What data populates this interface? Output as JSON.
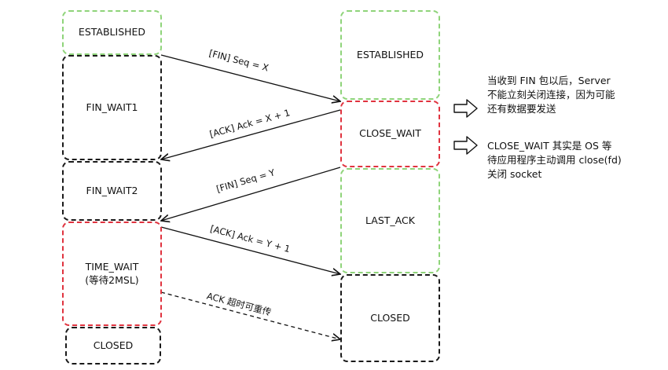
{
  "client": {
    "states": [
      {
        "id": "established",
        "label": "ESTABLISHED"
      },
      {
        "id": "fin_wait1",
        "label": "FIN_WAIT1"
      },
      {
        "id": "fin_wait2",
        "label": "FIN_WAIT2"
      },
      {
        "id": "time_wait",
        "label": "TIME_WAIT\n(等待2MSL)"
      },
      {
        "id": "closed",
        "label": "CLOSED"
      }
    ]
  },
  "server": {
    "states": [
      {
        "id": "established",
        "label": "ESTABLISHED"
      },
      {
        "id": "close_wait",
        "label": "CLOSE_WAIT"
      },
      {
        "id": "last_ack",
        "label": "LAST_ACK"
      },
      {
        "id": "closed",
        "label": "CLOSED"
      }
    ]
  },
  "messages": [
    {
      "label": "[FIN] Seq = X"
    },
    {
      "label": "[ACK] Ack = X + 1"
    },
    {
      "label": "[FIN] Seq = Y"
    },
    {
      "label": "[ACK] Ack = Y + 1"
    },
    {
      "label": "ACK 超时可重传"
    }
  ],
  "notes": [
    {
      "text": "当收到 FIN 包以后，Server\n不能立刻关闭连接，因为可能\n还有数据要发送"
    },
    {
      "text": "CLOSE_WAIT 其实是 OS 等\n待应用程序主动调用 close(fd)\n关闭 socket"
    }
  ],
  "colors": {
    "normal_state_border": "#8fd47a",
    "idle_state_border": "#1a1a1a",
    "highlight_state_border": "#e0333f",
    "line": "#111111"
  }
}
